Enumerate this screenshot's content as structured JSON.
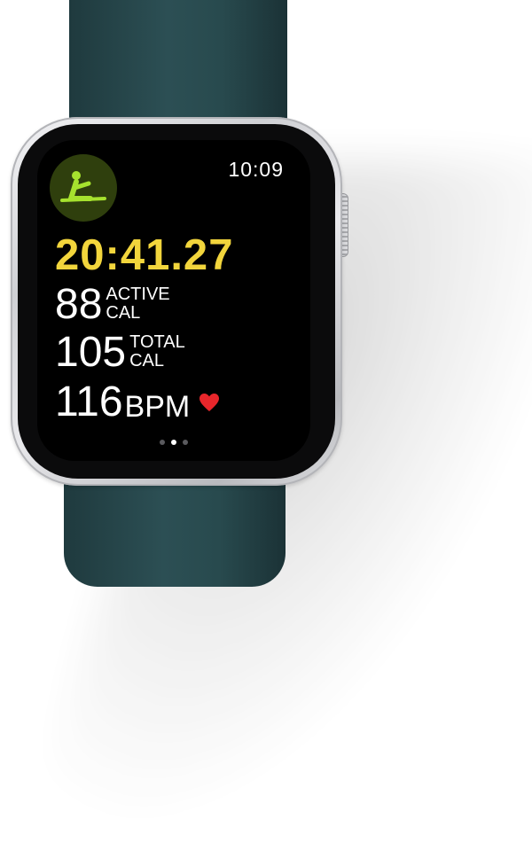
{
  "watch": {
    "time": "10:09",
    "workout_icon": "core-training-icon",
    "elapsed": "20:41.27",
    "active_calories": {
      "value": "88",
      "unit_line1": "ACTIVE",
      "unit_line2": "CAL"
    },
    "total_calories": {
      "value": "105",
      "unit_line1": "TOTAL",
      "unit_line2": "CAL"
    },
    "heart_rate": {
      "value": "116",
      "unit": "BPM",
      "icon": "heart-icon"
    },
    "page_indicator": {
      "pages": 3,
      "current": 2
    }
  },
  "colors": {
    "elapsed": "#f2d53c",
    "workout_icon_bg": "#2f3f0d",
    "workout_icon_fg": "#a6e22e",
    "heart": "#e8262b",
    "band": "#2c4f54"
  }
}
